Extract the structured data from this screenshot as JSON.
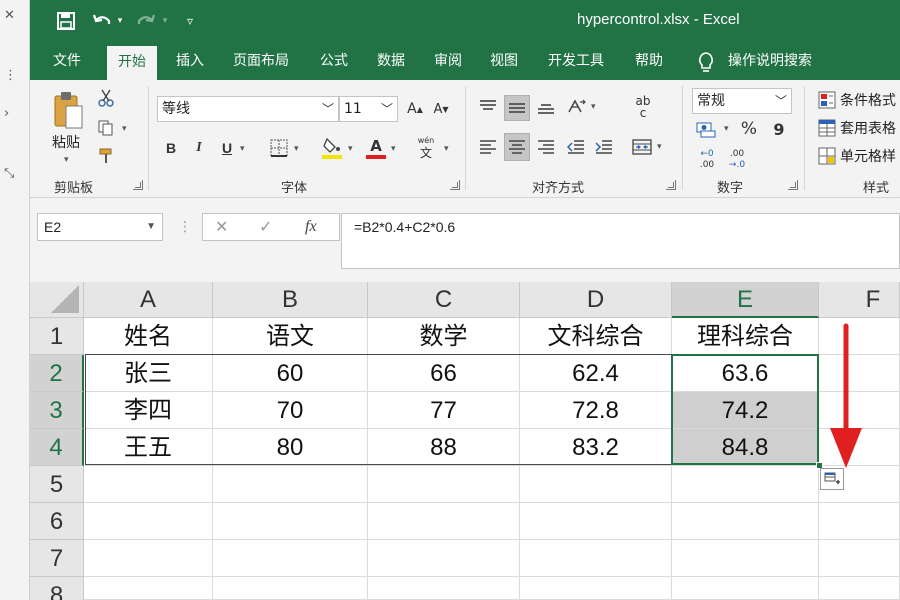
{
  "window": {
    "title": "hypercontrol.xlsx  -  Excel"
  },
  "quick_access": {
    "save_icon": "save-icon",
    "undo_icon": "undo-icon",
    "redo_icon": "redo-icon",
    "customize_icon": "customize-qat-icon"
  },
  "tabs": [
    {
      "label": "文件",
      "active": false
    },
    {
      "label": "开始",
      "active": true
    },
    {
      "label": "插入",
      "active": false
    },
    {
      "label": "页面布局",
      "active": false
    },
    {
      "label": "公式",
      "active": false
    },
    {
      "label": "数据",
      "active": false
    },
    {
      "label": "审阅",
      "active": false
    },
    {
      "label": "视图",
      "active": false
    },
    {
      "label": "开发工具",
      "active": false
    },
    {
      "label": "帮助",
      "active": false
    }
  ],
  "tell_me": {
    "label": "操作说明搜索"
  },
  "ribbon": {
    "clipboard": {
      "paste_label": "粘贴",
      "group_label": "剪贴板"
    },
    "font": {
      "font_name": "等线",
      "font_size": "11",
      "group_label": "字体",
      "bold": "B",
      "italic": "I",
      "underline": "U",
      "font_color_letter": "A",
      "phonetic_top": "wén",
      "phonetic_bottom": "文"
    },
    "alignment": {
      "group_label": "对齐方式",
      "wrap_top": "ab",
      "wrap_bottom": "c"
    },
    "number": {
      "format": "常规",
      "group_label": "数字",
      "percent": "%",
      "comma": "9",
      "inc_decimal_top": "←0",
      "inc_decimal_bottom": ".00",
      "dec_decimal_top": ".00",
      "dec_decimal_bottom": "→.0"
    },
    "styles": {
      "conditional_format": "条件格式",
      "table_format": "套用表格",
      "cell_styles": "单元格样",
      "group_label": "样式"
    }
  },
  "formula_bar": {
    "name_box": "E2",
    "cancel": "✕",
    "enter": "✓",
    "fx": "fx",
    "formula": "=B2*0.4+C2*0.6"
  },
  "columns": [
    "A",
    "B",
    "C",
    "D",
    "E",
    "F"
  ],
  "selected_column": "E",
  "rows": [
    "1",
    "2",
    "3",
    "4",
    "5",
    "6",
    "7",
    "8"
  ],
  "selected_rows": [
    "2",
    "3",
    "4"
  ],
  "table": [
    [
      "姓名",
      "语文",
      "数学",
      "文科综合",
      "理科综合"
    ],
    [
      "张三",
      "60",
      "66",
      "62.4",
      "63.6"
    ],
    [
      "李四",
      "70",
      "77",
      "72.8",
      "74.2"
    ],
    [
      "王五",
      "80",
      "88",
      "83.2",
      "84.8"
    ]
  ],
  "colors": {
    "excel_green": "#217346",
    "arrow_red": "#e02020",
    "selection_shade": "#cfcfcf"
  }
}
